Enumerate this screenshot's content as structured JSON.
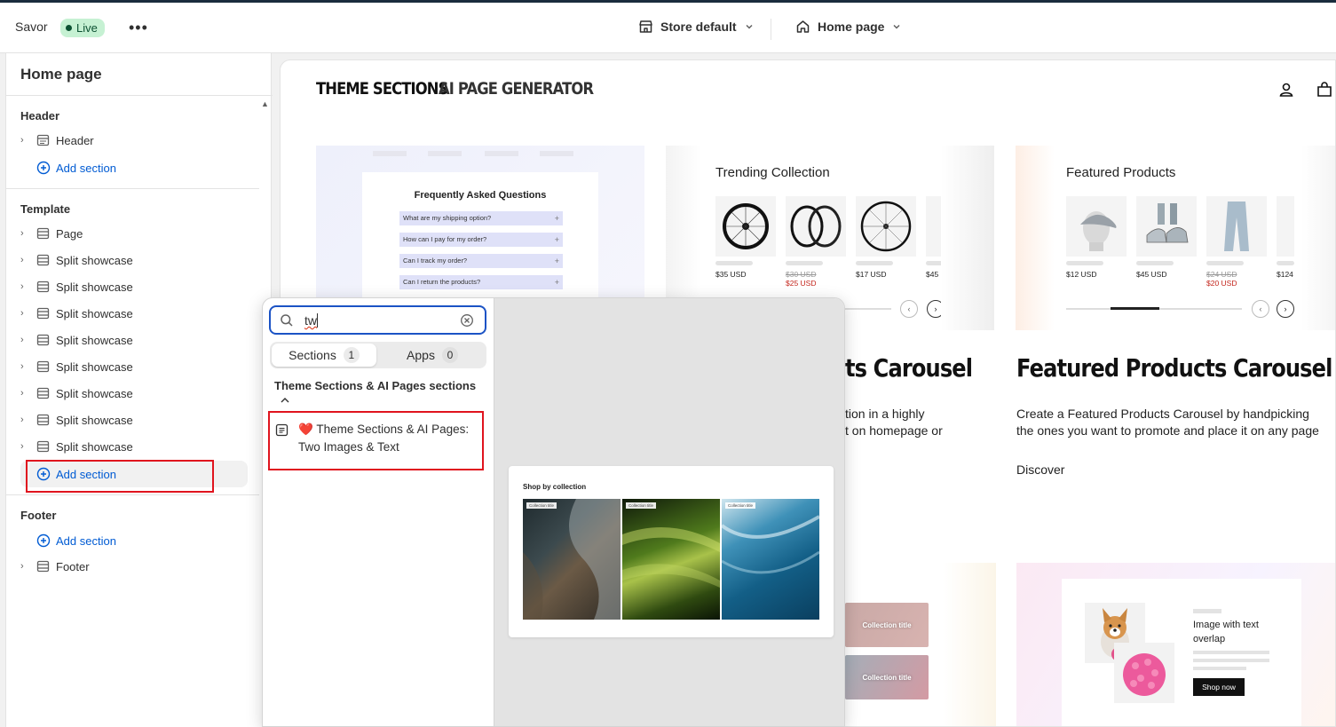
{
  "topbar": {
    "store_name": "Savor",
    "live_badge": "Live",
    "store_selector": "Store default",
    "page_selector": "Home page"
  },
  "sidebar": {
    "title": "Home page",
    "header_group": {
      "label": "Header",
      "items": [
        "Header"
      ],
      "add_label": "Add section"
    },
    "template_group": {
      "label": "Template",
      "items": [
        "Page",
        "Split showcase",
        "Split showcase",
        "Split showcase",
        "Split showcase",
        "Split showcase",
        "Split showcase",
        "Split showcase",
        "Split showcase"
      ],
      "add_label": "Add section"
    },
    "footer_group": {
      "label": "Footer",
      "add_label": "Add section",
      "items": [
        "Footer"
      ]
    }
  },
  "preview": {
    "nav_tabs": [
      "THEME SECTIONS",
      "AI PAGE GENERATOR"
    ],
    "faq": {
      "title": "Frequently Asked Questions",
      "questions": [
        "What are my shipping option?",
        "How can I pay for my order?",
        "Can I track my order?",
        "Can I return the products?"
      ]
    },
    "trending": {
      "heading": "Trending Collection",
      "prices": [
        "$35 USD",
        "$30 USD",
        "$25 USD",
        "$17 USD",
        "$45"
      ]
    },
    "featured": {
      "heading": "Featured Products",
      "prices": [
        "$12 USD",
        "$45 USD",
        "$24 USD",
        "$20 USD",
        "$124"
      ]
    },
    "middle_title": "ts Carousel",
    "middle_desc": [
      "tion in a highly",
      "t on homepage or"
    ],
    "right_title": "Featured Products Carousel",
    "right_desc": [
      "Create a Featured Products Carousel by handpicking",
      "the ones you want to promote and place it on any page"
    ],
    "discover": "Discover",
    "collection_tiles": [
      "Collection title",
      "Collection title"
    ],
    "overlay": {
      "heading": "Image with text overlap",
      "button": "Shop now"
    }
  },
  "popup": {
    "search_value": "tw",
    "tabs": [
      {
        "label": "Sections",
        "count": "1"
      },
      {
        "label": "Apps",
        "count": "0"
      }
    ],
    "result_group": "Theme Sections & AI Pages sections",
    "result_item": {
      "emoji": "❤️",
      "line1": "Theme Sections & AI Pages:",
      "line2": "Two Images & Text"
    },
    "preview": {
      "title": "Shop by collection",
      "tags": [
        "Collection title",
        "Collection title",
        "Collection title"
      ]
    }
  },
  "colors": {
    "accent": "#005bd3",
    "highlight_border": "#e0141e",
    "live_bg": "#c6f1d3",
    "search_focus": "#1b53c5"
  }
}
